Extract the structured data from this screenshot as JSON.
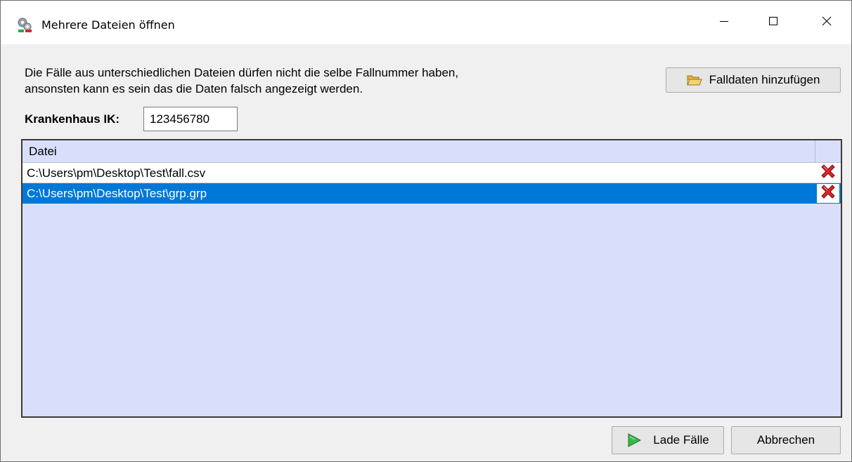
{
  "window": {
    "title": "Mehrere Dateien öffnen",
    "icons": {
      "app": "gears-icon",
      "minimize": "minimize-icon",
      "maximize": "maximize-icon",
      "close": "close-icon"
    }
  },
  "info": {
    "line1": "Die Fälle aus unterschiedlichen Dateien dürfen nicht die selbe Fallnummer haben,",
    "line2": "ansonsten kann es sein das die Daten falsch angezeigt werden."
  },
  "add_button": {
    "label": "Falldaten hinzufügen",
    "icon": "folder-open-icon"
  },
  "ik": {
    "label": "Krankenhaus IK:",
    "value": "123456780"
  },
  "table": {
    "header": "Datei",
    "rows": [
      {
        "file": "C:\\Users\\pm\\Desktop\\Test\\fall.csv",
        "selected": false,
        "delete_icon": "delete-x-icon"
      },
      {
        "file": "C:\\Users\\pm\\Desktop\\Test\\grp.grp",
        "selected": true,
        "delete_icon": "delete-x-icon"
      }
    ]
  },
  "buttons": {
    "load": {
      "label": "Lade Fälle",
      "icon": "play-arrow-icon"
    },
    "cancel": {
      "label": "Abbrechen"
    }
  },
  "colors": {
    "selection": "#0078d7",
    "table_bg": "#d9dffa",
    "dialog_bg": "#f0f0f0",
    "delete_red": "#d9232a",
    "play_green": "#3ab54a"
  }
}
